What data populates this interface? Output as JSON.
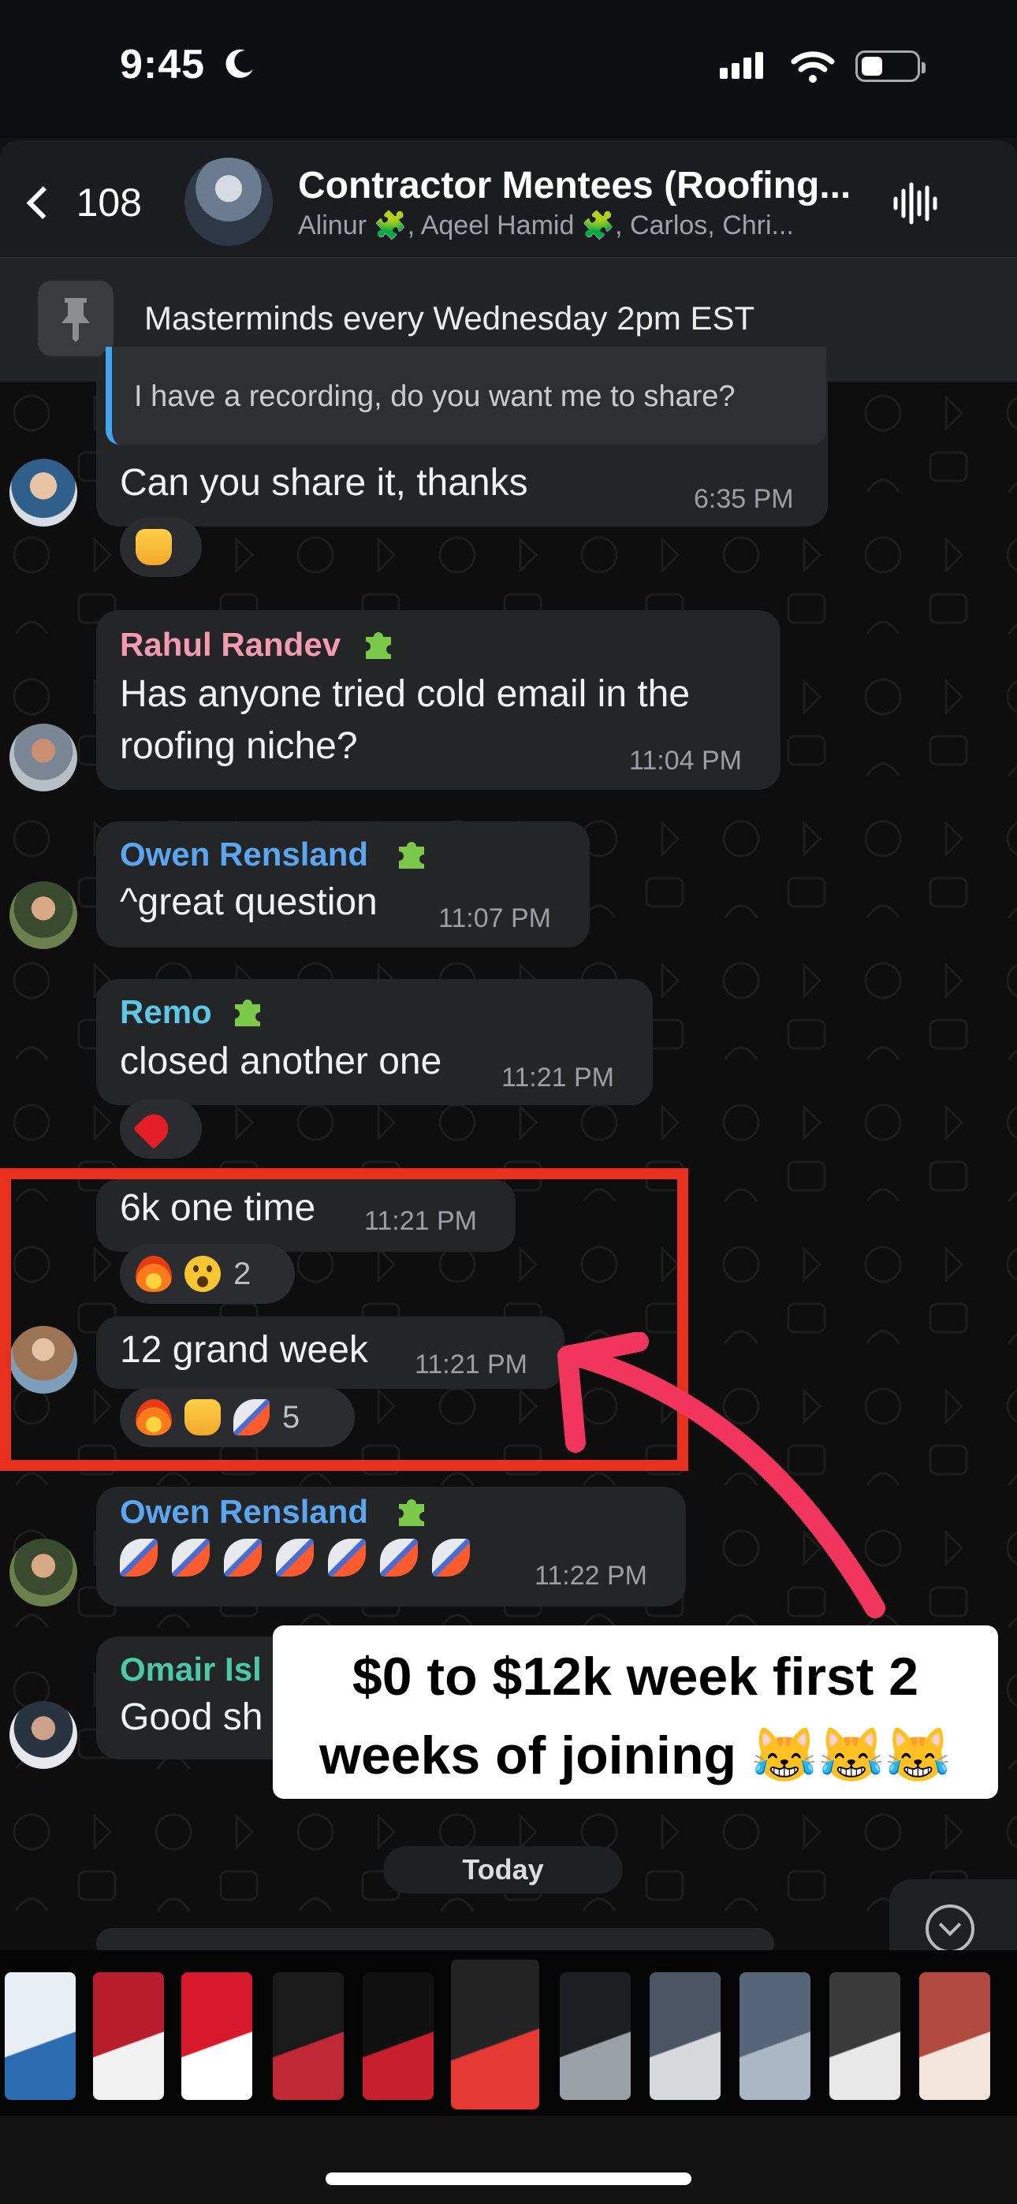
{
  "status_bar": {
    "time": "9:45"
  },
  "header": {
    "back_count": "108",
    "title": "Contractor Mentees (Roofing...",
    "members": "Alinur 🧩, Aqeel Hamid 🧩, Carlos, Chri..."
  },
  "pinned": {
    "text": "Masterminds every Wednesday 2pm EST"
  },
  "messages": [
    {
      "quote": "I have a recording, do you want me to share?",
      "text": "Can you share it, thanks",
      "time": "6:35 PM",
      "reactions": [
        "thumbs-up"
      ]
    },
    {
      "sender": "Rahul Randev",
      "text_lines": [
        "Has anyone tried cold email in the",
        "roofing niche?"
      ],
      "time": "11:04 PM"
    },
    {
      "sender": "Owen Rensland",
      "text": "^great question",
      "time": "11:07 PM"
    },
    {
      "sender": "Remo",
      "text": "closed another one",
      "time": "11:21 PM",
      "reactions": [
        "red-heart"
      ]
    },
    {
      "text": "6k one time",
      "time": "11:21 PM",
      "reactions": [
        "fire",
        "astonished-face"
      ],
      "reaction_count": "2"
    },
    {
      "text": "12 grand week",
      "time": "11:21 PM",
      "reactions": [
        "fire",
        "thumbs-up",
        "rocket"
      ],
      "reaction_count": "5"
    },
    {
      "sender": "Owen Rensland",
      "emoji": "rocket",
      "emoji_repeat": 7,
      "time": "11:22 PM"
    },
    {
      "sender": "Omair Isl",
      "text": "Good sh"
    }
  ],
  "sender_colors": {
    "Rahul Randev": "#f49ab1",
    "Owen Rensland": "#5aa6f0",
    "Remo": "#5bc8e8",
    "Omair Isl": "#4cc9a6"
  },
  "annotation": {
    "caption": "$0 to $12k week first 2\nweeks of joining 😹😹😹",
    "highlight_color": "#e8301f",
    "arrow_color": "#f2355d"
  },
  "date_divider": "Today",
  "icons": [
    "back-chevron-icon",
    "moon-icon",
    "signal-icon",
    "wifi-icon",
    "battery-icon",
    "audio-waveform-icon",
    "pin-icon",
    "puzzle-piece-icon",
    "scroll-down-icon"
  ]
}
